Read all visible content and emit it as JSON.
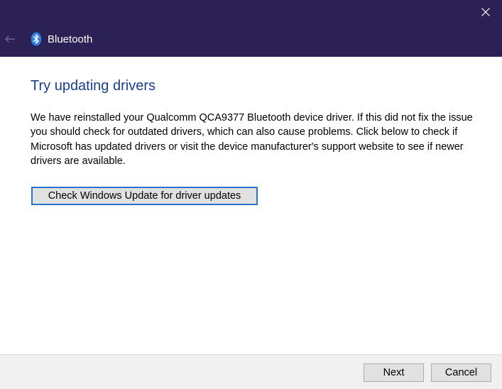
{
  "titlebar": {
    "title": "Bluetooth",
    "background_color": "#2b2154",
    "back_icon": "back-arrow-icon",
    "app_icon": "bluetooth-icon",
    "close_icon": "close-icon"
  },
  "main": {
    "heading": "Try updating drivers",
    "heading_color": "#1a3f8f",
    "body": "We have reinstalled your Qualcomm QCA9377 Bluetooth device driver. If this did not fix the issue you should check for outdated drivers, which can also cause problems. Click below to check if Microsoft has updated drivers or visit the device manufacturer's support website to see if newer drivers are available.",
    "update_button_label": "Check Windows Update for driver updates"
  },
  "footer": {
    "next_label": "Next",
    "cancel_label": "Cancel"
  }
}
